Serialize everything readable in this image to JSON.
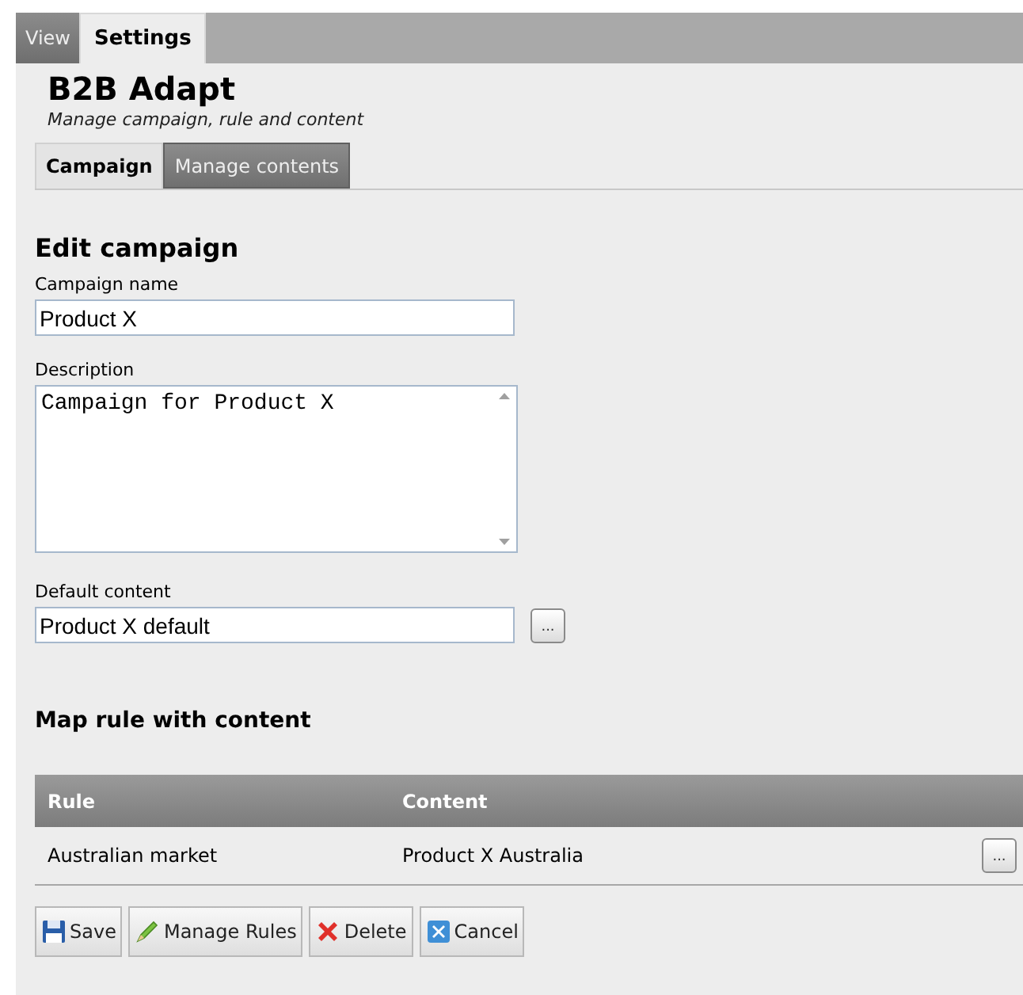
{
  "top_tabs": [
    {
      "label": "View",
      "selected": false
    },
    {
      "label": "Settings",
      "selected": true
    }
  ],
  "header": {
    "title": "B2B Adapt",
    "subtitle": "Manage campaign, rule and content"
  },
  "section_tabs": [
    {
      "label": "Campaign",
      "selected": true
    },
    {
      "label": "Manage contents",
      "selected": false
    }
  ],
  "form": {
    "heading": "Edit campaign",
    "campaign_name": {
      "label": "Campaign name",
      "value": "Product X"
    },
    "description": {
      "label": "Description",
      "value": "Campaign for Product X"
    },
    "default_content": {
      "label": "Default content",
      "value": "Product X default",
      "browse": "..."
    }
  },
  "map_rules": {
    "heading": "Map rule with content",
    "columns": [
      "Rule",
      "Content"
    ],
    "rows": [
      {
        "rule": "Australian market",
        "content": "Product X Australia",
        "browse": "..."
      }
    ]
  },
  "buttons": [
    {
      "kind": "save",
      "label": "Save"
    },
    {
      "kind": "rules",
      "label": "Manage Rules"
    },
    {
      "kind": "delete",
      "label": "Delete"
    },
    {
      "kind": "cancel",
      "label": "Cancel"
    }
  ]
}
